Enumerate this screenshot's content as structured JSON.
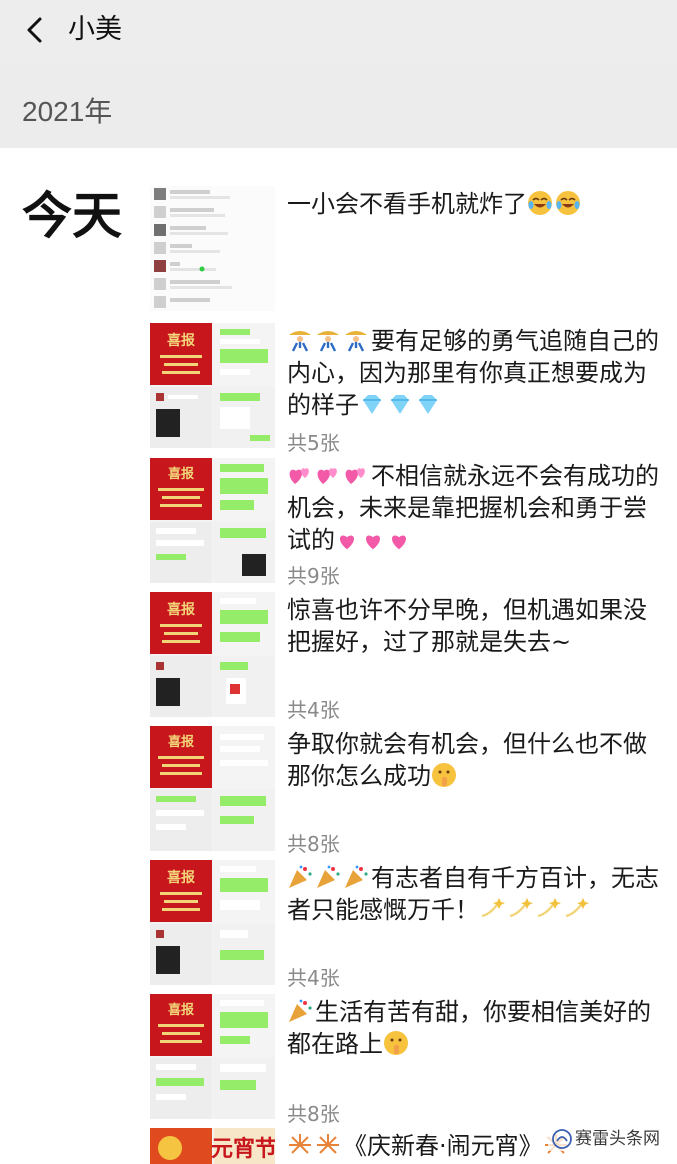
{
  "header": {
    "back_icon": "chevron-left-icon",
    "title": "小美"
  },
  "section": {
    "year": "2021年",
    "day_label": "今天"
  },
  "posts": [
    {
      "text": "一小会不看手机就炸了",
      "emoji": [
        "laugh-cry-emoji",
        "laugh-cry-emoji"
      ],
      "thumbnail": "chat-list-screenshot",
      "count": ""
    },
    {
      "text": "要有足够的勇气追随自己的内心，因为那里有你真正想要成为的样子",
      "emoji_prefix": [
        "dancers-emoji",
        "dancers-emoji",
        "dancers-emoji"
      ],
      "emoji": [
        "diamond-emoji",
        "diamond-emoji",
        "diamond-emoji"
      ],
      "thumbnail": "collage-red-poster-chats",
      "count": "共5张"
    },
    {
      "text": "不相信就永远不会有成功的机会，未来是靠把握机会和勇于尝试的",
      "emoji_prefix": [
        "hearts-emoji",
        "hearts-emoji",
        "hearts-emoji"
      ],
      "emoji": [
        "heart-emoji",
        "heart-emoji",
        "heart-emoji"
      ],
      "thumbnail": "collage-red-poster-chats",
      "count": "共9张"
    },
    {
      "text": "惊喜也许不分早晚，但机遇如果没把握好，过了那就是失去~",
      "thumbnail": "collage-red-poster-chats",
      "count": "共4张"
    },
    {
      "text": "争取你就会有机会，但什么也不做那你怎么成功",
      "emoji": [
        "shush-emoji"
      ],
      "thumbnail": "collage-red-poster-chats",
      "count": "共8张"
    },
    {
      "text": "有志者自有千方百计，无志者只能感慨万千！",
      "emoji_prefix": [
        "party-popper-emoji",
        "party-popper-emoji",
        "party-popper-emoji"
      ],
      "emoji": [
        "dizzy-emoji",
        "dizzy-emoji",
        "dizzy-emoji",
        "dizzy-emoji"
      ],
      "thumbnail": "collage-red-poster-chats",
      "count": "共4张"
    },
    {
      "text": "生活有苦有甜，你要相信美好的都在路上",
      "emoji_prefix": [
        "party-popper-emoji"
      ],
      "emoji": [
        "shush-emoji"
      ],
      "thumbnail": "collage-red-poster-chats",
      "count": "共8张"
    },
    {
      "text": "《庆新春·闹元宵》",
      "emoji_prefix": [
        "fireworks-emoji",
        "fireworks-emoji"
      ],
      "emoji": [
        "fireworks-emoji",
        "fireworks-emoji"
      ],
      "thumbnail": "lantern-festival-banner",
      "thumbnail_text": "元宵节",
      "count": ""
    }
  ],
  "watermark": {
    "text": "赛雷头条网",
    "icon": "site-logo-icon"
  },
  "colors": {
    "header_bg": "#ededed",
    "poster_red": "#c8161d",
    "chat_green": "#95ec69",
    "count_gray": "#8a8a8a"
  }
}
